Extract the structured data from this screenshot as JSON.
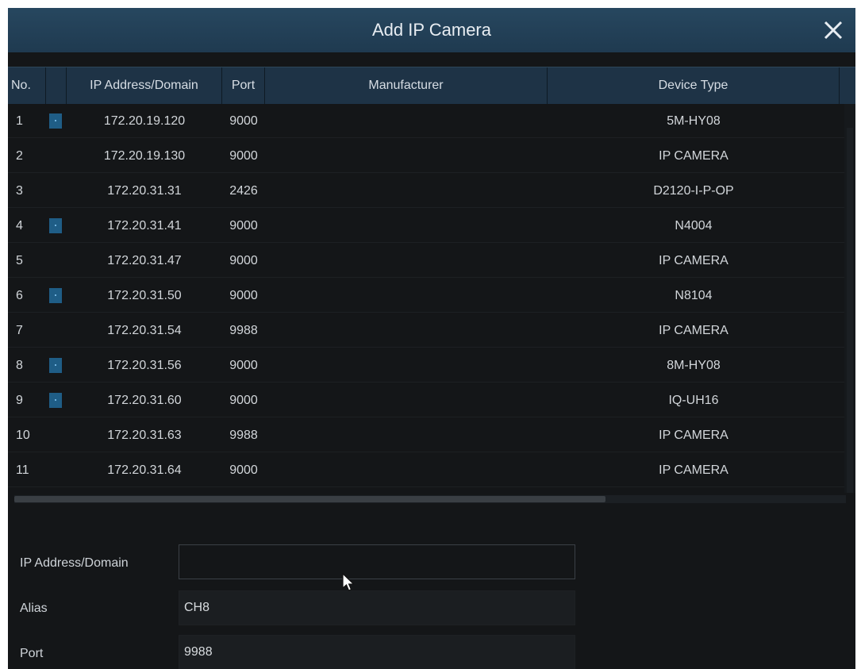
{
  "dialog": {
    "title": "Add IP Camera",
    "close_icon": "close-icon"
  },
  "table": {
    "columns": [
      "No.",
      "",
      "IP Address/Domain",
      "Port",
      "Manufacturer",
      "Device Type"
    ],
    "rows": [
      {
        "no": "1",
        "added": true,
        "ip": "172.20.19.120",
        "port": "9000",
        "manufacturer": "",
        "device_type": "5M-HY08"
      },
      {
        "no": "2",
        "added": false,
        "ip": "172.20.19.130",
        "port": "9000",
        "manufacturer": "",
        "device_type": "IP CAMERA"
      },
      {
        "no": "3",
        "added": false,
        "ip": "172.20.31.31",
        "port": "2426",
        "manufacturer": "",
        "device_type": "D2120-I-P-OP"
      },
      {
        "no": "4",
        "added": true,
        "ip": "172.20.31.41",
        "port": "9000",
        "manufacturer": "",
        "device_type": "N4004"
      },
      {
        "no": "5",
        "added": false,
        "ip": "172.20.31.47",
        "port": "9000",
        "manufacturer": "",
        "device_type": "IP CAMERA"
      },
      {
        "no": "6",
        "added": true,
        "ip": "172.20.31.50",
        "port": "9000",
        "manufacturer": "",
        "device_type": "N8104"
      },
      {
        "no": "7",
        "added": false,
        "ip": "172.20.31.54",
        "port": "9988",
        "manufacturer": "",
        "device_type": "IP CAMERA"
      },
      {
        "no": "8",
        "added": true,
        "ip": "172.20.31.56",
        "port": "9000",
        "manufacturer": "",
        "device_type": "8M-HY08"
      },
      {
        "no": "9",
        "added": true,
        "ip": "172.20.31.60",
        "port": "9000",
        "manufacturer": "",
        "device_type": "IQ-UH16"
      },
      {
        "no": "10",
        "added": false,
        "ip": "172.20.31.63",
        "port": "9988",
        "manufacturer": "",
        "device_type": "IP CAMERA"
      },
      {
        "no": "11",
        "added": false,
        "ip": "172.20.31.64",
        "port": "9000",
        "manufacturer": "",
        "device_type": "IP CAMERA"
      }
    ]
  },
  "form": {
    "ip_label": "IP Address/Domain",
    "ip_value": "",
    "alias_label": "Alias",
    "alias_value": "CH8",
    "port_label": "Port",
    "port_value": "9988"
  },
  "colors": {
    "title_bar": "#1f3a50",
    "header_bg": "#1e3346",
    "body_bg": "#141618",
    "added_marker": "#1f5d86"
  }
}
